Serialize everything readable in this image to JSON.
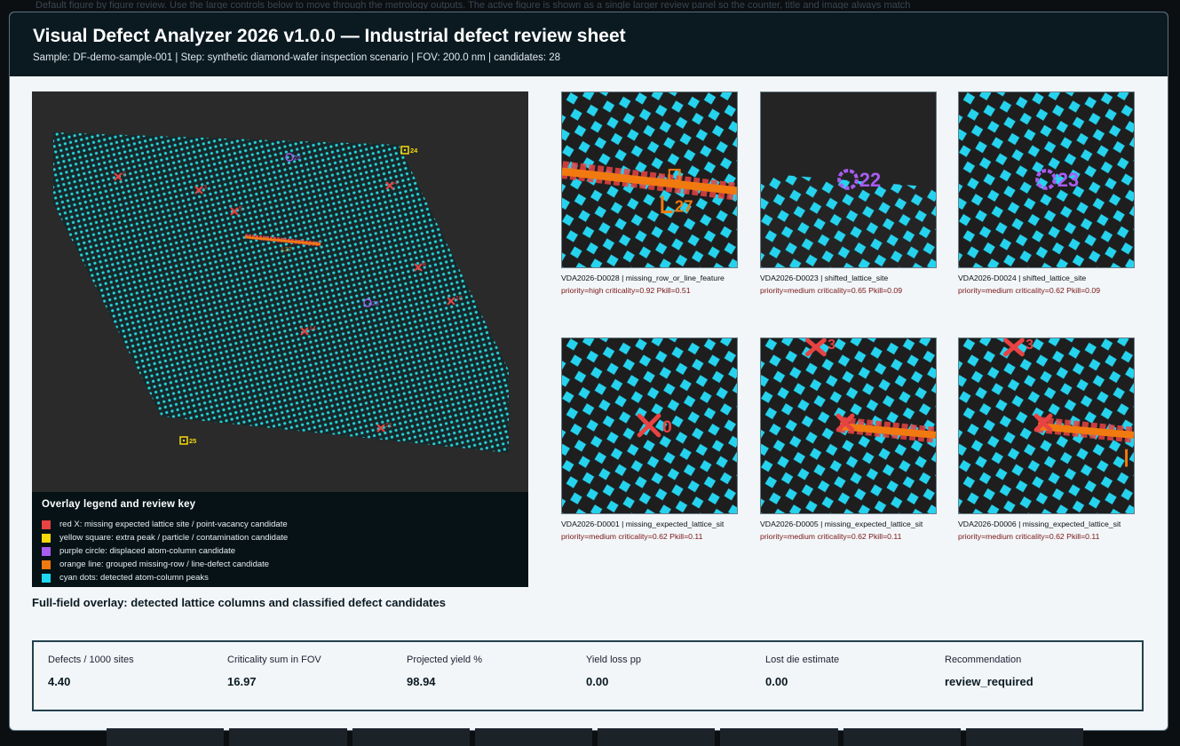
{
  "header": {
    "title": "Visual Defect Analyzer 2026 v1.0.0 — Industrial defect review sheet",
    "subtitle": "Sample: DF-demo-sample-001 | Step: synthetic diamond-wafer inspection scenario | FOV: 200.0 nm | candidates: 28"
  },
  "background_note": "Default figure by figure review. Use the large controls below to move through the metrology outputs. The active figure is shown as a single larger review panel so the counter, title and image always match",
  "overlay": {
    "markers": {
      "red_x": [
        "0",
        "3",
        "4",
        "5",
        "8",
        "10",
        "11",
        "14",
        "15",
        "21"
      ],
      "yellow_sq": [
        "24",
        "25"
      ],
      "purple_circle": [
        "22",
        "23"
      ],
      "orange_line": [
        "27"
      ]
    }
  },
  "legend": {
    "title": "Overlay legend and review key",
    "items": [
      {
        "color": "#e84343",
        "label": "red X: missing expected lattice site / point-vacancy candidate"
      },
      {
        "color": "#f5d90a",
        "label": "yellow square: extra peak / particle / contamination candidate"
      },
      {
        "color": "#a85cf2",
        "label": "purple circle: displaced atom-column candidate"
      },
      {
        "color": "#f07a10",
        "label": "orange line: grouped missing-row / line-defect candidate"
      },
      {
        "color": "#1ed8f2",
        "label": "cyan dots: detected atom-column peaks"
      }
    ]
  },
  "caption": "Full-field overlay: detected lattice columns and classified defect candidates",
  "tiles": [
    {
      "label": "VDA2026-D0028 | missing_row_or_line_feature",
      "meta": "priority=high  criticality=0.92  Pkill=0.51",
      "marker": "L27"
    },
    {
      "label": "VDA2026-D0023 | shifted_lattice_site",
      "meta": "priority=medium  criticality=0.65  Pkill=0.09",
      "marker": "22"
    },
    {
      "label": "VDA2026-D0024 | shifted_lattice_site",
      "meta": "priority=medium  criticality=0.62  Pkill=0.09",
      "marker": "23"
    },
    {
      "label": "VDA2026-D0001 | missing_expected_lattice_sit",
      "meta": "priority=medium  criticality=0.62  Pkill=0.11",
      "marker": "0"
    },
    {
      "label": "VDA2026-D0005 | missing_expected_lattice_sit",
      "meta": "priority=medium  criticality=0.62  Pkill=0.11",
      "marker": "3"
    },
    {
      "label": "VDA2026-D0006 | missing_expected_lattice_sit",
      "meta": "priority=medium  criticality=0.62  Pkill=0.11",
      "marker": "3"
    }
  ],
  "metrics": [
    {
      "label": "Defects / 1000 sites",
      "value": "4.40"
    },
    {
      "label": "Criticality sum in FOV",
      "value": "16.97"
    },
    {
      "label": "Projected yield %",
      "value": "98.94"
    },
    {
      "label": "Yield loss pp",
      "value": "0.00"
    },
    {
      "label": "Lost die estimate",
      "value": "0.00"
    },
    {
      "label": "Recommendation",
      "value": "review_required"
    }
  ]
}
